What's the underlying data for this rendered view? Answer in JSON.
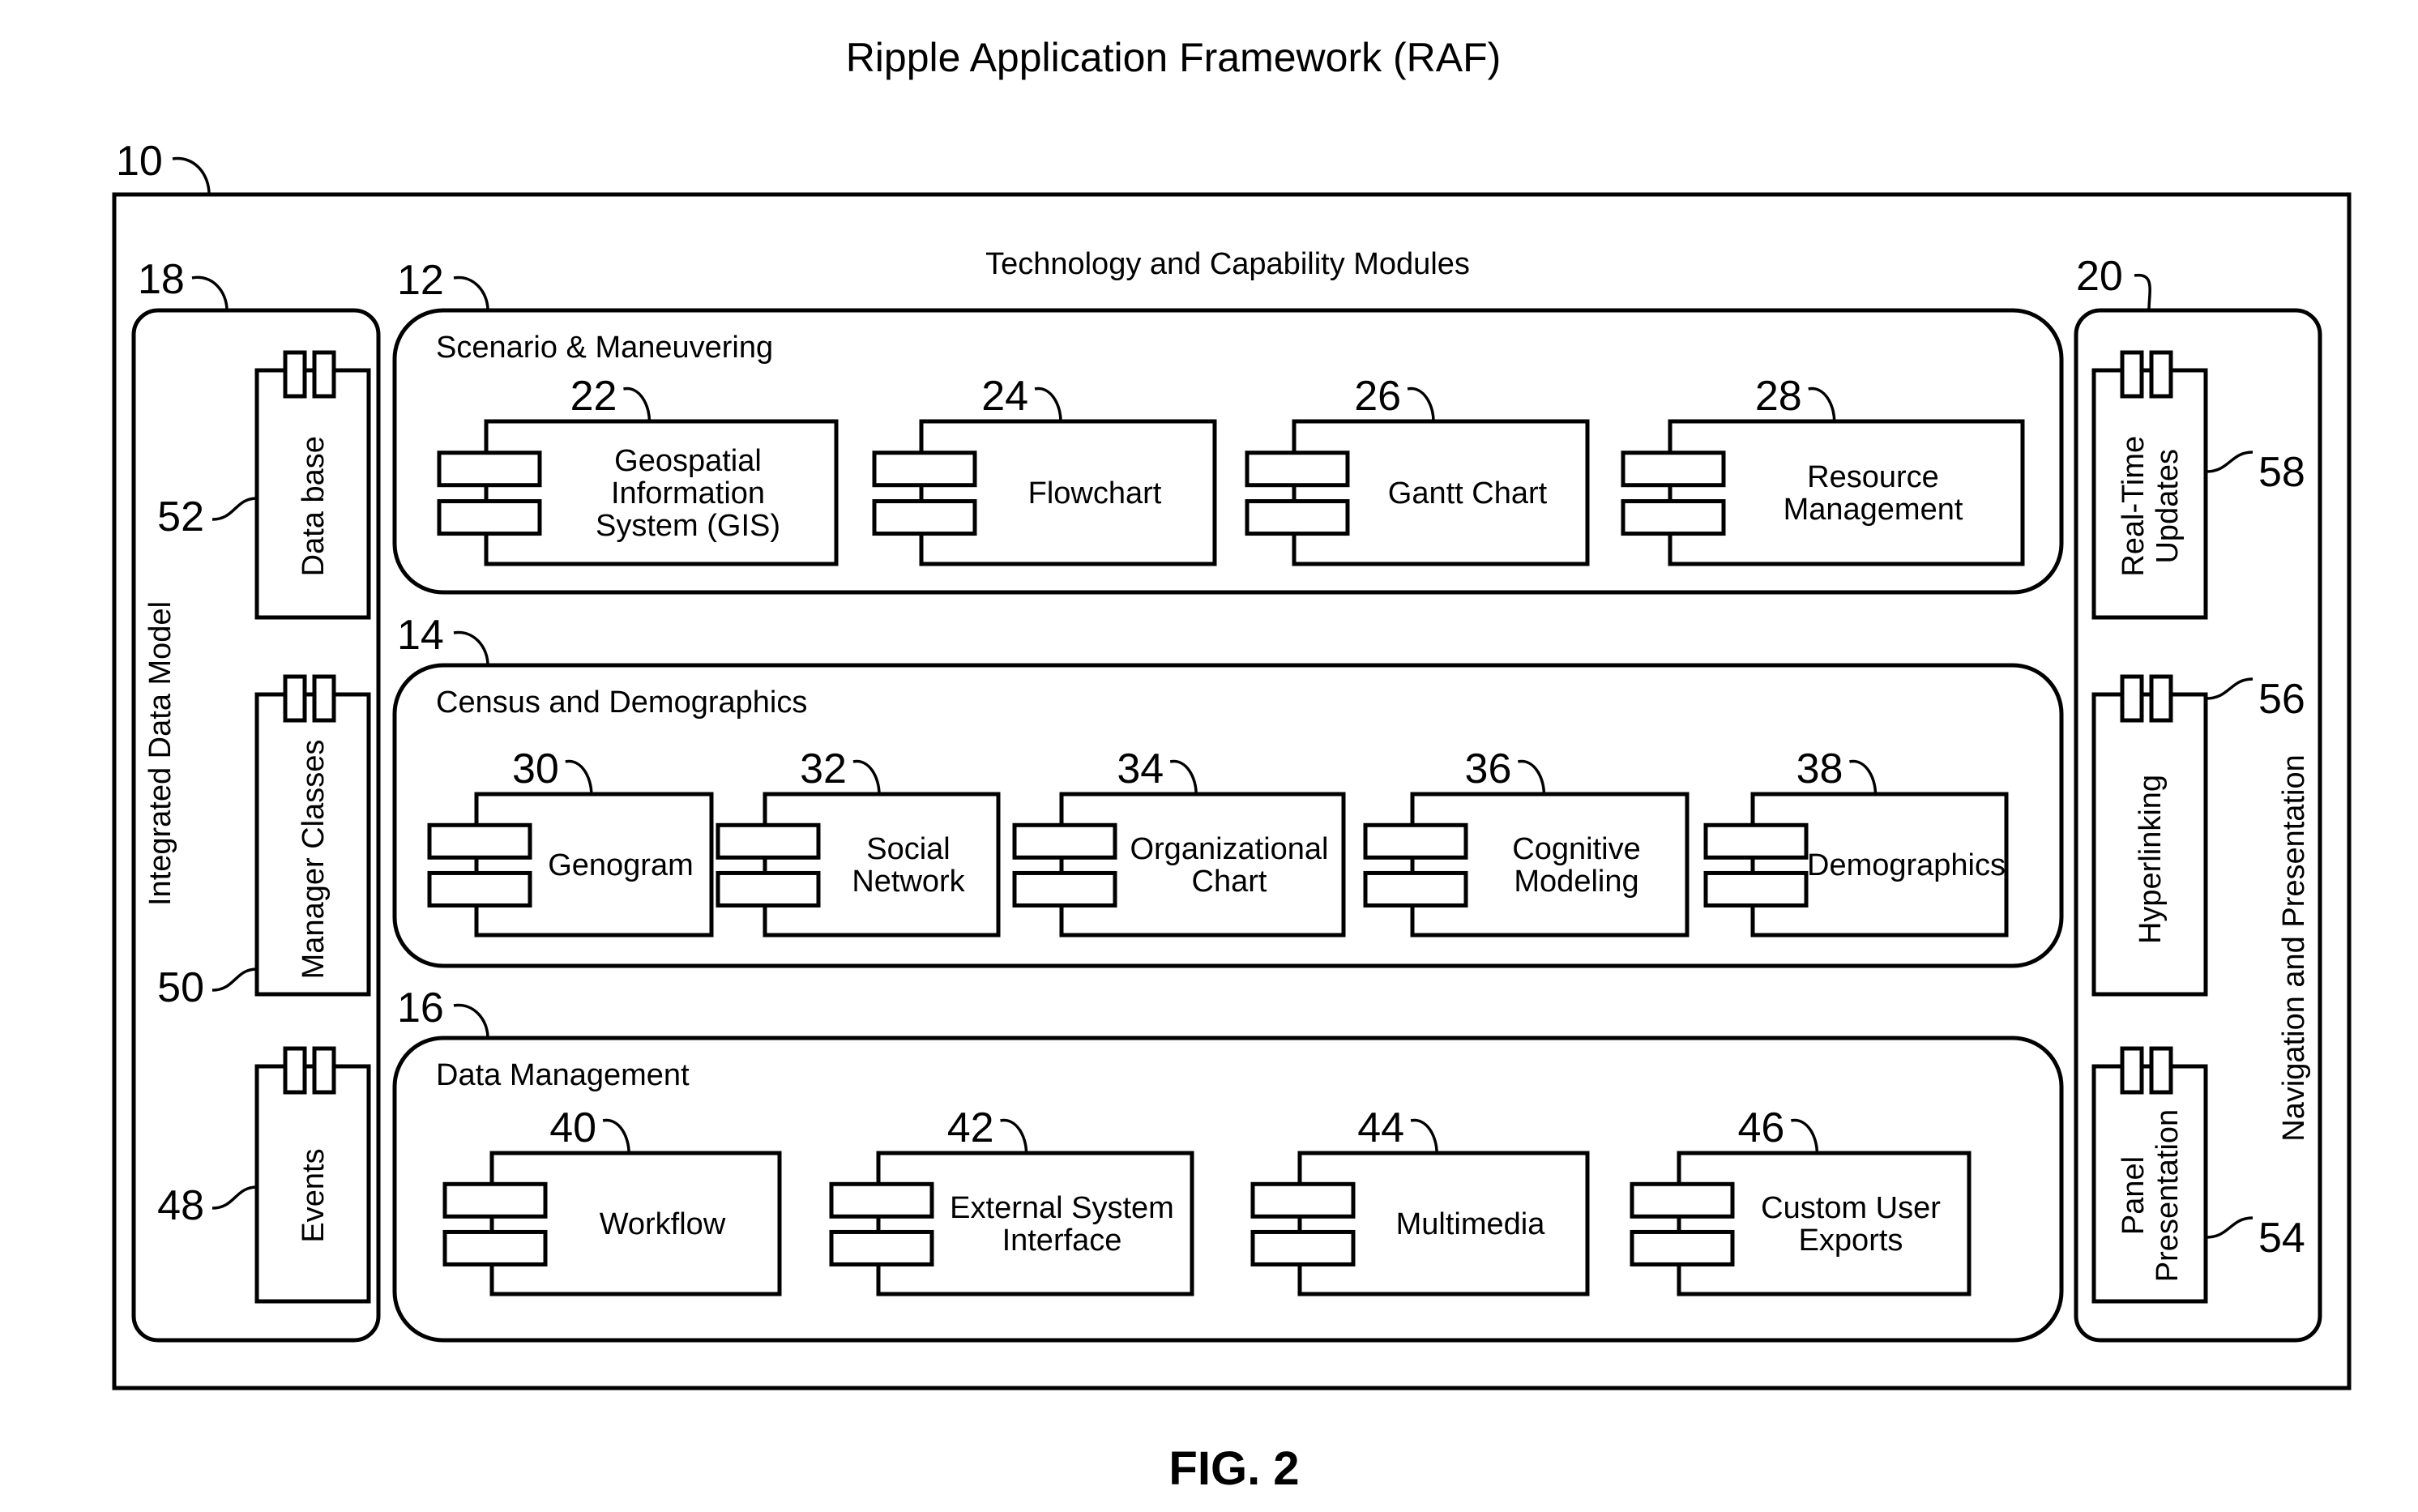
{
  "title": "Ripple Application Framework (RAF)",
  "figure_label": "FIG. 2",
  "framework": {
    "ref": "10",
    "label": "Technology and Capability Modules"
  },
  "left_panel": {
    "ref": "18",
    "label": "Integrated Data Model",
    "components": [
      {
        "ref": "52",
        "label": "Data base"
      },
      {
        "ref": "50",
        "label": "Manager Classes"
      },
      {
        "ref": "48",
        "label": "Events"
      }
    ]
  },
  "right_panel": {
    "ref": "20",
    "label": "Navigation and Presentation",
    "components": [
      {
        "ref": "58",
        "lines": [
          "Real-Time",
          "Updates"
        ]
      },
      {
        "ref": "56",
        "lines": [
          "Hyperlinking"
        ]
      },
      {
        "ref": "54",
        "lines": [
          "Panel",
          "Presentation"
        ]
      }
    ]
  },
  "groups": [
    {
      "ref": "12",
      "label": "Scenario & Maneuvering",
      "components": [
        {
          "ref": "22",
          "lines": [
            "Geospatial",
            "Information",
            "System (GIS)"
          ]
        },
        {
          "ref": "24",
          "lines": [
            "Flowchart"
          ]
        },
        {
          "ref": "26",
          "lines": [
            "Gantt Chart"
          ]
        },
        {
          "ref": "28",
          "lines": [
            "Resource",
            "Management"
          ]
        }
      ]
    },
    {
      "ref": "14",
      "label": "Census and Demographics",
      "components": [
        {
          "ref": "30",
          "lines": [
            "Genogram"
          ]
        },
        {
          "ref": "32",
          "lines": [
            "Social",
            "Network"
          ]
        },
        {
          "ref": "34",
          "lines": [
            "Organizational",
            "Chart"
          ]
        },
        {
          "ref": "36",
          "lines": [
            "Cognitive",
            "Modeling"
          ]
        },
        {
          "ref": "38",
          "lines": [
            "Demographics"
          ]
        }
      ]
    },
    {
      "ref": "16",
      "label": "Data Management",
      "components": [
        {
          "ref": "40",
          "lines": [
            "Workflow"
          ]
        },
        {
          "ref": "42",
          "lines": [
            "External System",
            "Interface"
          ]
        },
        {
          "ref": "44",
          "lines": [
            "Multimedia"
          ]
        },
        {
          "ref": "46",
          "lines": [
            "Custom User",
            "Exports"
          ]
        }
      ]
    }
  ]
}
